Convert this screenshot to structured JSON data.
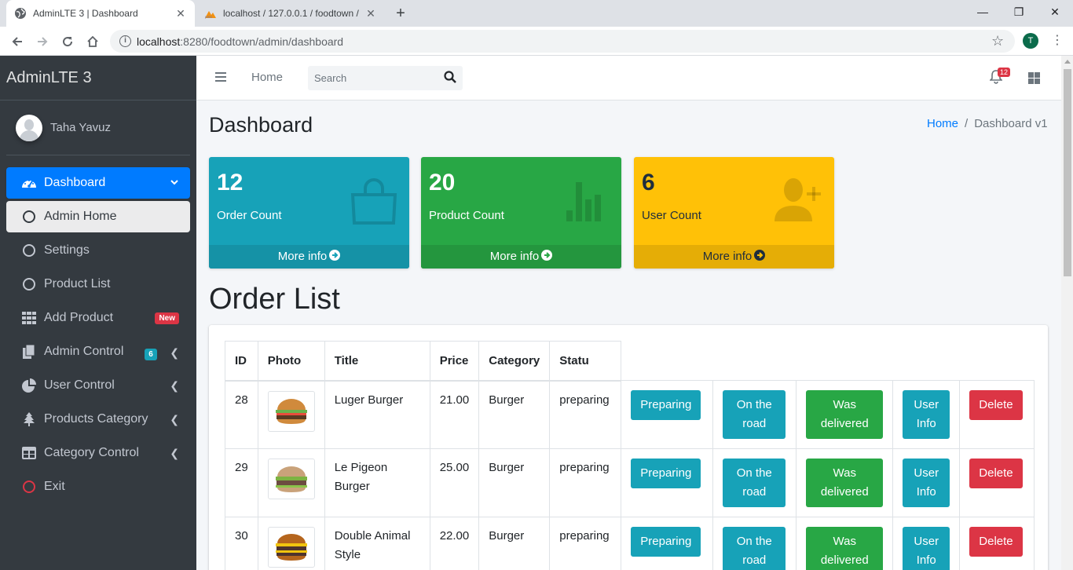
{
  "browser": {
    "tabs": [
      {
        "title": "AdminLTE 3 | Dashboard",
        "active": true
      },
      {
        "title": "localhost / 127.0.0.1 / foodtown /",
        "active": false
      }
    ],
    "url_host": "localhost",
    "url_path": ":8280/foodtown/admin/dashboard",
    "profile_initial": "T"
  },
  "sidebar": {
    "brand": "AdminLTE 3",
    "user": "Taha Yavuz",
    "items": [
      {
        "label": "Dashboard",
        "icon": "tachometer-icon"
      },
      {
        "label": "Admin Home",
        "icon": "circle-icon"
      },
      {
        "label": "Settings",
        "icon": "circle-icon"
      },
      {
        "label": "Product List",
        "icon": "circle-icon"
      },
      {
        "label": "Add Product",
        "icon": "grid-icon",
        "badge": "New"
      },
      {
        "label": "Admin Control",
        "icon": "copy-icon",
        "badge": "6"
      },
      {
        "label": "User Control",
        "icon": "pie-chart-icon"
      },
      {
        "label": "Products Category",
        "icon": "tree-icon"
      },
      {
        "label": "Category Control",
        "icon": "table-icon"
      },
      {
        "label": "Exit",
        "icon": "circle-icon"
      }
    ]
  },
  "header": {
    "home": "Home",
    "search_placeholder": "Search",
    "notifications": "12"
  },
  "page": {
    "title": "Dashboard",
    "breadcrumb": {
      "home": "Home",
      "sep": "/",
      "current": "Dashboard v1"
    }
  },
  "stats": [
    {
      "value": "12",
      "label": "Order Count",
      "link": "More info",
      "icon": "shopping-bag-icon"
    },
    {
      "value": "20",
      "label": "Product Count",
      "link": "More info",
      "icon": "bar-chart-icon"
    },
    {
      "value": "6",
      "label": "User Count",
      "link": "More info",
      "icon": "user-plus-icon"
    }
  ],
  "orders": {
    "title": "Order List",
    "columns": [
      "ID",
      "Photo",
      "Title",
      "Price",
      "Category",
      "Statu"
    ],
    "actions": {
      "preparing": "Preparing",
      "on_road": "On the road",
      "delivered": "Was delivered",
      "user_info": "User Info",
      "delete": "Delete"
    },
    "rows": [
      {
        "id": "28",
        "title": "Luger Burger",
        "price": "21.00",
        "category": "Burger",
        "status": "preparing"
      },
      {
        "id": "29",
        "title": "Le Pigeon Burger",
        "price": "25.00",
        "category": "Burger",
        "status": "preparing"
      },
      {
        "id": "30",
        "title": "Double Animal Style",
        "price": "22.00",
        "category": "Burger",
        "status": "preparing"
      }
    ]
  },
  "colors": {
    "sidebar_bg": "#343a40",
    "primary": "#007bff",
    "info": "#17a2b8",
    "success": "#28a745",
    "warning": "#ffc107",
    "danger": "#dc3545"
  }
}
